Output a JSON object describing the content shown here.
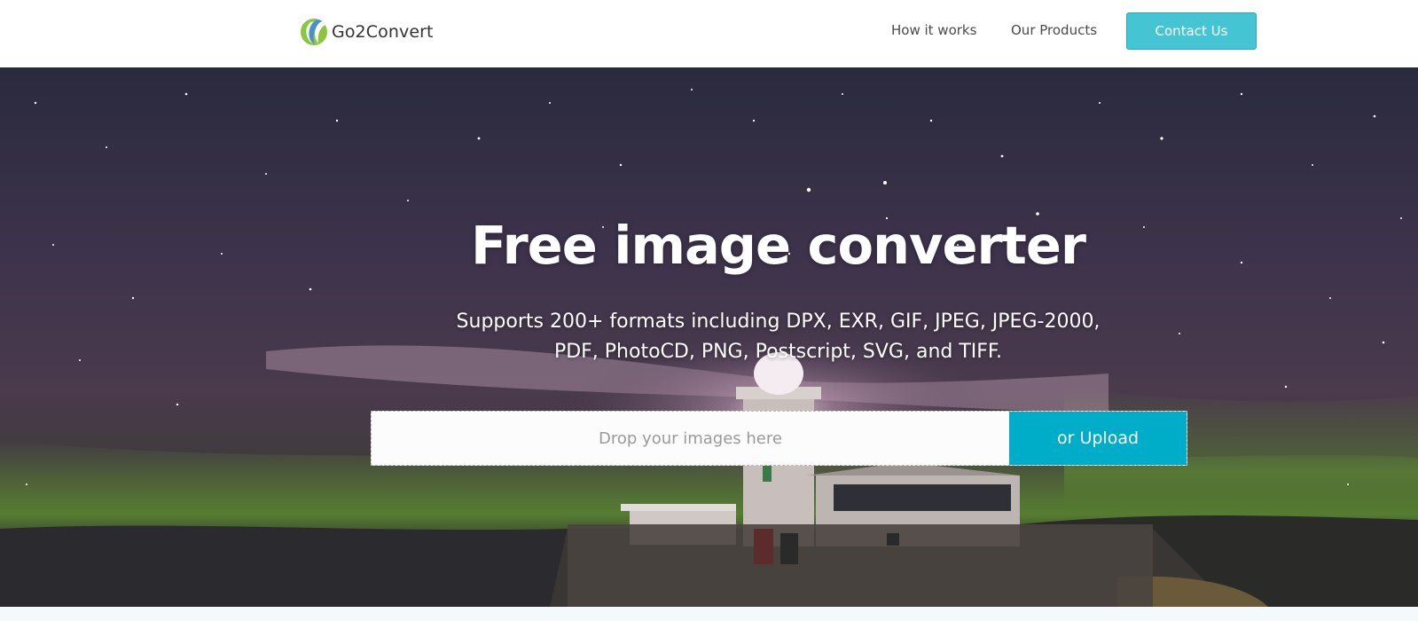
{
  "header": {
    "logo_text": "Go2Convert",
    "nav": {
      "how_it_works": "How it works",
      "our_products": "Our Products"
    },
    "contact_label": "Contact Us"
  },
  "hero": {
    "title": "Free image converter",
    "subtitle_line1": "Supports 200+ formats including DPX, EXR, GIF, JPEG, JPEG-2000,",
    "subtitle_line2": "PDF, PhotoCD, PNG, Postscript, SVG, and TIFF.",
    "dropzone_text": "Drop your images here",
    "upload_label": "or Upload"
  },
  "colors": {
    "accent": "#45c4d4",
    "upload": "#00adc8",
    "hero_text": "#ffffff"
  },
  "icons": [
    "logo-icon"
  ]
}
